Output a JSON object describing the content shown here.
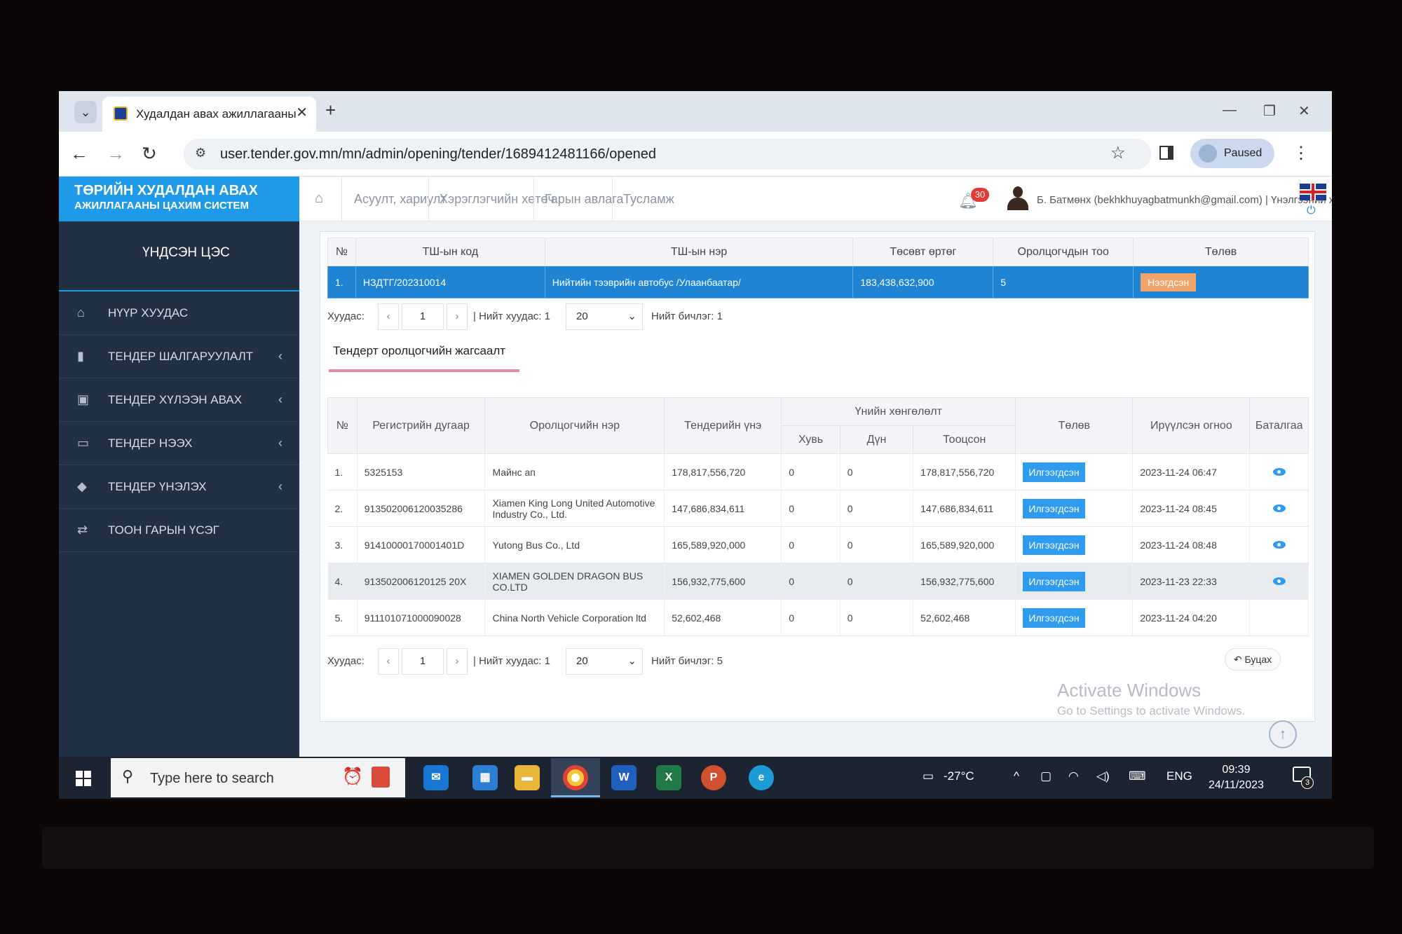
{
  "browser": {
    "tab_title": "Худалдан авах ажиллагааны",
    "url": "user.tender.gov.mn/mn/admin/opening/tender/1689412481166/opened",
    "paused_label": "Paused"
  },
  "header": {
    "logo_line1": "ТӨРИЙН ХУДАЛДАН АВАХ",
    "logo_line2": "АЖИЛЛАГААНЫ ЦАХИМ СИСТЕМ",
    "nav": [
      "Асуулт, хариулт",
      "Хэрэглэгчийн хөтөч",
      "Гарын авлага",
      "Тусламж"
    ],
    "notification_count": "30",
    "user": "Б. Батмөнх (bekhkhuyagbatmunkh@gmail.com) | Үнэлгээний хороо"
  },
  "sidebar": {
    "title": "ҮНДСЭН ЦЭС",
    "items": [
      {
        "label": "НҮҮР ХУУДАС",
        "icon": "home-icon"
      },
      {
        "label": "ТЕНДЕР ШАЛГАРУУЛАЛТ",
        "icon": "file-icon"
      },
      {
        "label": "ТЕНДЕР ХҮЛЭЭН АВАХ",
        "icon": "inbox-icon"
      },
      {
        "label": "ТЕНДЕР НЭЭХ",
        "icon": "folder-open-icon"
      },
      {
        "label": "ТЕНДЕР ҮНЭЛЭХ",
        "icon": "tag-icon"
      },
      {
        "label": "ТООН ГАРЫН ҮСЭГ",
        "icon": "exchange-icon"
      }
    ]
  },
  "tender_table": {
    "headers": [
      "№",
      "ТШ-ын код",
      "ТШ-ын нэр",
      "Төсөвт өртөг",
      "Оролцогчдын тоо",
      "Төлөв"
    ],
    "row": {
      "num": "1.",
      "code": "НЗДТГ/202310014",
      "name": "Нийтийн тээврийн автобус /Улаанбаатар/",
      "budget": "183,438,632,900",
      "participants": "5",
      "status": "Нээгдсэн"
    }
  },
  "pager1": {
    "label": "Хуудас:",
    "page": "1",
    "total_pages": "| Нийт хуудас: 1",
    "page_size": "20",
    "total_records": "Нийт бичлэг: 1"
  },
  "subtab": "Тендерт оролцогчийн жагсаалт",
  "bidders": {
    "headers": {
      "num": "№",
      "reg": "Регистрийн дугаар",
      "name": "Оролцогчийн нэр",
      "price": "Тендерийн үнэ",
      "discount_group": "Үнийн хөнгөлөлт",
      "pct": "Хувь",
      "amount": "Дүн",
      "computed": "Тооцсон",
      "status": "Төлөв",
      "submitted": "Ирүүлсэн огноо",
      "confirm": "Баталгаа"
    },
    "rows": [
      {
        "num": "1.",
        "reg": "5325153",
        "name": "Майнс ап",
        "price": "178,817,556,720",
        "pct": "0",
        "amount": "0",
        "computed": "178,817,556,720",
        "status": "Илгээгдсэн",
        "date": "2023-11-24 06:47",
        "has_eye": true
      },
      {
        "num": "2.",
        "reg": "913502006120035286",
        "name": "Xiamen King Long United Automotive Industry Co., Ltd.",
        "price": "147,686,834,611",
        "pct": "0",
        "amount": "0",
        "computed": "147,686,834,611",
        "status": "Илгээгдсэн",
        "date": "2023-11-24 08:45",
        "has_eye": true
      },
      {
        "num": "3.",
        "reg": "91410000170001401D",
        "name": "Yutong Bus Co., Ltd",
        "price": "165,589,920,000",
        "pct": "0",
        "amount": "0",
        "computed": "165,589,920,000",
        "status": "Илгээгдсэн",
        "date": "2023-11-24 08:48",
        "has_eye": true
      },
      {
        "num": "4.",
        "reg": "913502006120125 20X",
        "name": "XIAMEN GOLDEN DRAGON BUS CO.LTD",
        "price": "156,932,775,600",
        "pct": "0",
        "amount": "0",
        "computed": "156,932,775,600",
        "status": "Илгээгдсэн",
        "date": "2023-11-23 22:33",
        "has_eye": true
      },
      {
        "num": "5.",
        "reg": "911101071000090028",
        "name": "China North Vehicle Corporation ltd",
        "price": "52,602,468",
        "pct": "0",
        "amount": "0",
        "computed": "52,602,468",
        "status": "Илгээгдсэн",
        "date": "2023-11-24 04:20",
        "has_eye": false
      }
    ]
  },
  "pager2": {
    "label": "Хуудас:",
    "page": "1",
    "total_pages": "| Нийт хуудас: 1",
    "page_size": "20",
    "total_records": "Нийт бичлэг: 5"
  },
  "back_label": "Буцах",
  "watermark": {
    "line1": "Activate Windows",
    "line2": "Go to Settings to activate Windows."
  },
  "taskbar": {
    "search_placeholder": "Type here to search",
    "temperature": "-27°C",
    "lang": "ENG",
    "time": "09:39",
    "date": "24/11/2023",
    "notif_count": "3"
  },
  "colors": {
    "brand_blue": "#1f9ae8",
    "sidebar": "#223044",
    "status_orange": "#f0a46c",
    "status_blue": "#2f9bee"
  }
}
